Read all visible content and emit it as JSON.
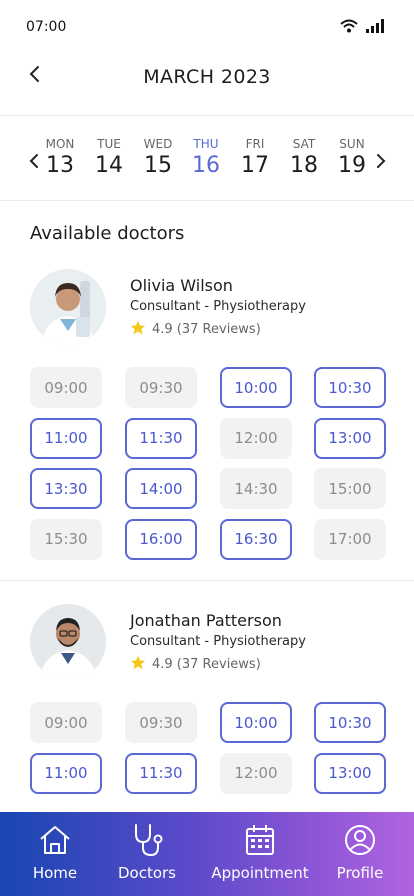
{
  "status_bar": {
    "time": "07:00",
    "icons": [
      "wifi-icon",
      "signal-icon"
    ]
  },
  "header": {
    "title": "MARCH 2023",
    "back_icon": "chevron-left-icon"
  },
  "week": {
    "days": [
      {
        "name": "MON",
        "num": "13"
      },
      {
        "name": "TUE",
        "num": "14"
      },
      {
        "name": "WED",
        "num": "15"
      },
      {
        "name": "THU",
        "num": "16"
      },
      {
        "name": "FRI",
        "num": "17"
      },
      {
        "name": "SAT",
        "num": "18"
      },
      {
        "name": "SUN",
        "num": "19"
      }
    ],
    "selected_day": "THU",
    "accent_color": "#5a68d6"
  },
  "section_title": "Available doctors",
  "doctors": [
    {
      "name": "Olivia Wilson",
      "specialty": "Consultant - Physiotherapy",
      "rating": "4.9 (37 Reviews)",
      "slots": [
        {
          "time": "09:00",
          "available": false
        },
        {
          "time": "09:30",
          "available": false
        },
        {
          "time": "10:00",
          "available": true
        },
        {
          "time": "10:30",
          "available": true
        },
        {
          "time": "11:00",
          "available": true
        },
        {
          "time": "11:30",
          "available": true
        },
        {
          "time": "12:00",
          "available": false
        },
        {
          "time": "13:00",
          "available": true
        },
        {
          "time": "13:30",
          "available": true
        },
        {
          "time": "14:00",
          "available": true
        },
        {
          "time": "14:30",
          "available": false
        },
        {
          "time": "15:00",
          "available": false
        },
        {
          "time": "15:30",
          "available": false
        },
        {
          "time": "16:00",
          "available": true
        },
        {
          "time": "16:30",
          "available": true
        },
        {
          "time": "17:00",
          "available": false
        }
      ]
    },
    {
      "name": "Jonathan Patterson",
      "specialty": "Consultant - Physiotherapy",
      "rating": "4.9 (37 Reviews)",
      "slots": [
        {
          "time": "09:00",
          "available": false
        },
        {
          "time": "09:30",
          "available": false
        },
        {
          "time": "10:00",
          "available": true
        },
        {
          "time": "10:30",
          "available": true
        },
        {
          "time": "11:00",
          "available": true
        },
        {
          "time": "11:30",
          "available": true
        },
        {
          "time": "12:00",
          "available": false
        },
        {
          "time": "13:00",
          "available": true
        }
      ]
    }
  ],
  "tabbar": {
    "items": [
      {
        "label": "Home",
        "icon": "home-icon"
      },
      {
        "label": "Doctors",
        "icon": "stethoscope-icon"
      },
      {
        "label": "Appointment",
        "icon": "calendar-icon"
      },
      {
        "label": "Profile",
        "icon": "user-icon"
      }
    ]
  },
  "colors": {
    "accent": "#5a68d6",
    "slot_busy_bg": "#f2f2f2",
    "star": "#f5c518"
  }
}
